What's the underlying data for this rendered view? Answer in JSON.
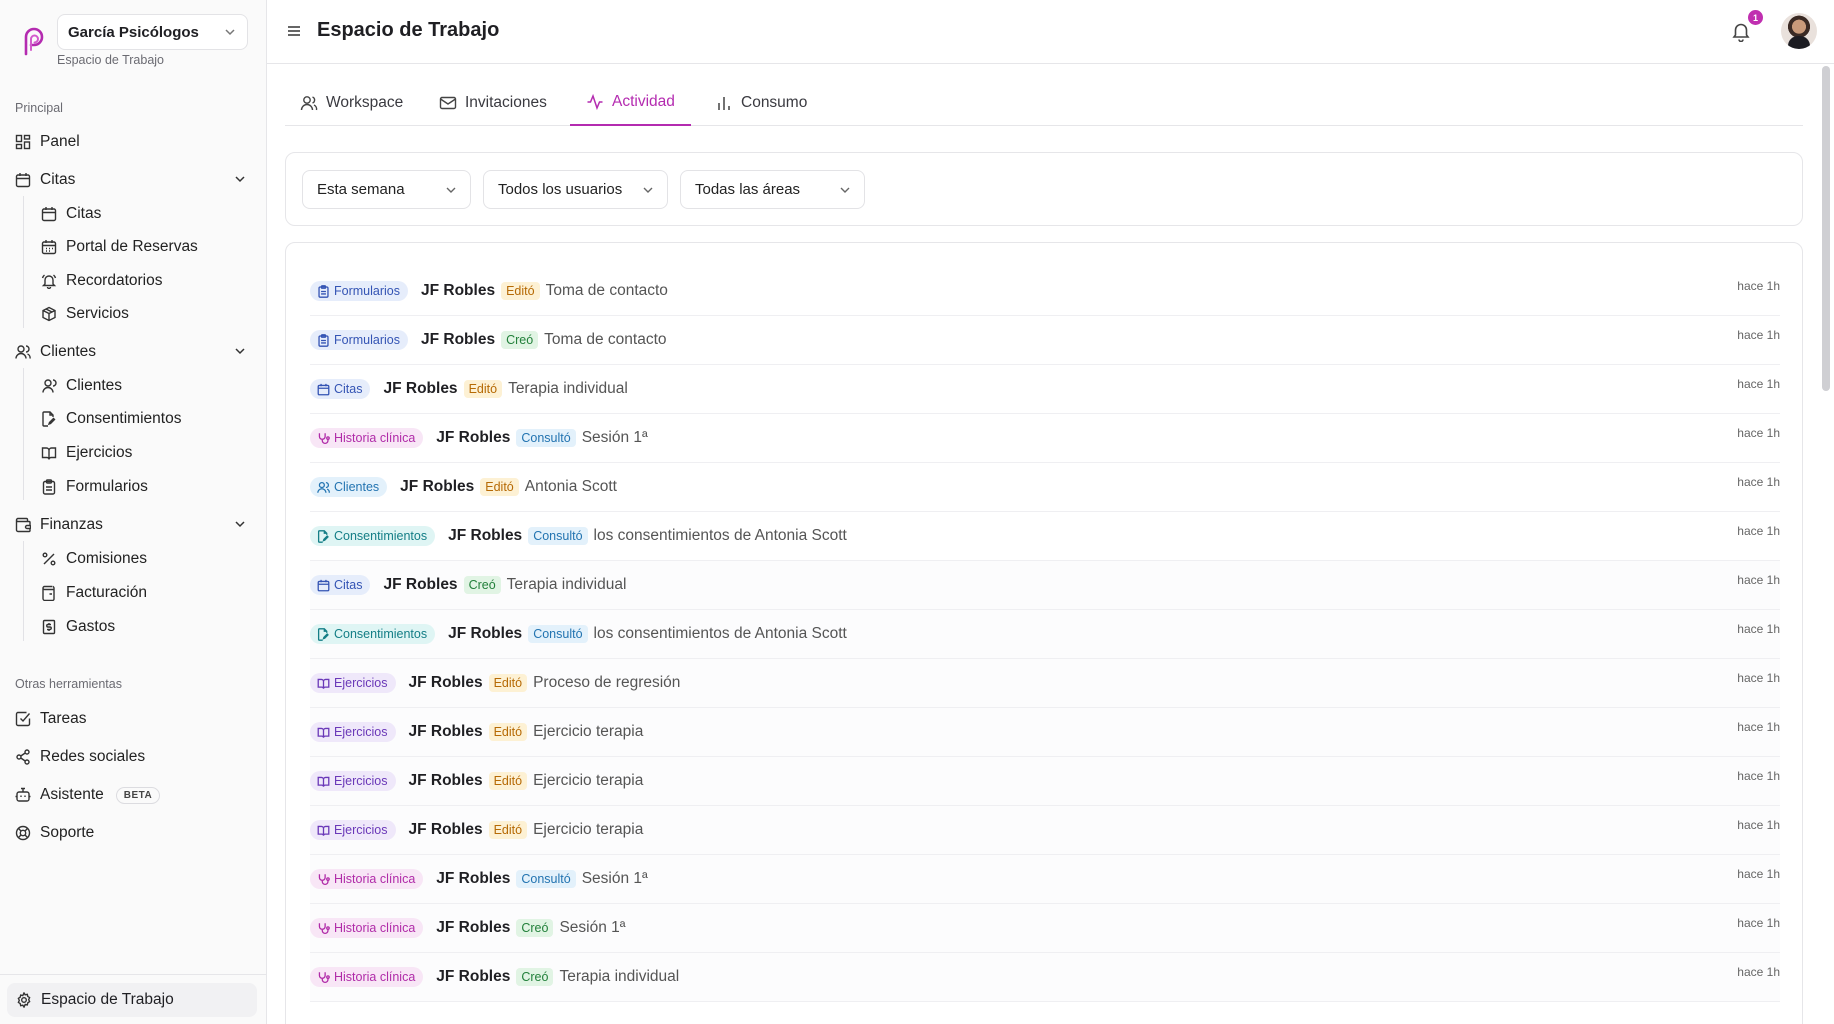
{
  "sidebar": {
    "workspace_name": "García Psicólogos",
    "workspace_sub": "Espacio de Trabajo",
    "sections": {
      "principal": "Principal",
      "otras": "Otras herramientas"
    },
    "panel": "Panel",
    "citas": {
      "label": "Citas",
      "children": [
        "Citas",
        "Portal de Reservas",
        "Recordatorios",
        "Servicios"
      ]
    },
    "clientes": {
      "label": "Clientes",
      "children": [
        "Clientes",
        "Consentimientos",
        "Ejercicios",
        "Formularios"
      ]
    },
    "finanzas": {
      "label": "Finanzas",
      "children": [
        "Comisiones",
        "Facturación",
        "Gastos"
      ]
    },
    "tools": {
      "tareas": "Tareas",
      "redes": "Redes sociales",
      "asistente": "Asistente",
      "asistente_badge": "BETA",
      "soporte": "Soporte"
    },
    "footer": "Espacio de Trabajo"
  },
  "header": {
    "title": "Espacio de Trabajo",
    "notification_count": "1"
  },
  "tabs": [
    "Workspace",
    "Invitaciones",
    "Actividad",
    "Consumo"
  ],
  "active_tab": "Actividad",
  "filters": [
    "Esta semana",
    "Todos los usuarios",
    "Todas las áreas"
  ],
  "activity": [
    {
      "category": "Formularios",
      "user": "JF Robles",
      "action": "Editó",
      "target": "Toma de contacto",
      "time": "hace 1h"
    },
    {
      "category": "Formularios",
      "user": "JF Robles",
      "action": "Creó",
      "target": "Toma de contacto",
      "time": "hace 1h"
    },
    {
      "category": "Citas",
      "user": "JF Robles",
      "action": "Editó",
      "target": "Terapia individual",
      "time": "hace 1h"
    },
    {
      "category": "Historia clínica",
      "user": "JF Robles",
      "action": "Consultó",
      "target": "Sesión 1ª",
      "time": "hace 1h"
    },
    {
      "category": "Clientes",
      "user": "JF Robles",
      "action": "Editó",
      "target": "Antonia Scott",
      "time": "hace 1h"
    },
    {
      "category": "Consentimientos",
      "user": "JF Robles",
      "action": "Consultó",
      "target": "los consentimientos de Antonia Scott",
      "time": "hace 1h"
    },
    {
      "category": "Citas",
      "user": "JF Robles",
      "action": "Creó",
      "target": "Terapia individual",
      "time": "hace 1h"
    },
    {
      "category": "Consentimientos",
      "user": "JF Robles",
      "action": "Consultó",
      "target": "los consentimientos de Antonia Scott",
      "time": "hace 1h"
    },
    {
      "category": "Ejercicios",
      "user": "JF Robles",
      "action": "Editó",
      "target": "Proceso de regresión",
      "time": "hace 1h"
    },
    {
      "category": "Ejercicios",
      "user": "JF Robles",
      "action": "Editó",
      "target": "Ejercicio terapia",
      "time": "hace 1h"
    },
    {
      "category": "Ejercicios",
      "user": "JF Robles",
      "action": "Editó",
      "target": "Ejercicio terapia",
      "time": "hace 1h"
    },
    {
      "category": "Ejercicios",
      "user": "JF Robles",
      "action": "Editó",
      "target": "Ejercicio terapia",
      "time": "hace 1h"
    },
    {
      "category": "Historia clínica",
      "user": "JF Robles",
      "action": "Consultó",
      "target": "Sesión 1ª",
      "time": "hace 1h"
    },
    {
      "category": "Historia clínica",
      "user": "JF Robles",
      "action": "Creó",
      "target": "Sesión 1ª",
      "time": "hace 1h"
    },
    {
      "category": "Historia clínica",
      "user": "JF Robles",
      "action": "Creó",
      "target": "Terapia individual",
      "time": "hace 1h"
    }
  ],
  "colors": {
    "accent": "#b42bb0",
    "badge": "#c02fb0"
  }
}
